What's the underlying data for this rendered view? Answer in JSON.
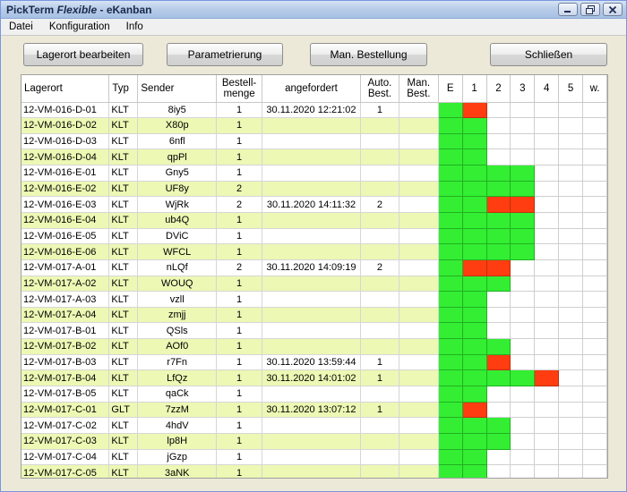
{
  "window": {
    "title_part1": "PickTerm ",
    "title_part2": "Flexible",
    "title_part3": " - eKanban",
    "minimize_icon": "minimize-icon",
    "maximize_icon": "restore-icon",
    "close_icon": "close-icon"
  },
  "menu": {
    "items": [
      "Datei",
      "Konfiguration",
      "Info"
    ]
  },
  "toolbar": {
    "edit_label": "Lagerort bearbeiten",
    "params_label": "Parametrierung",
    "order_label": "Man. Bestellung",
    "close_label": "Schließen"
  },
  "table": {
    "headers": {
      "lagerort": "Lagerort",
      "typ": "Typ",
      "sender": "Sender",
      "bestellmenge_1": "Bestell-",
      "bestellmenge_2": "menge",
      "angefordert": "angefordert",
      "auto_1": "Auto.",
      "auto_2": "Best.",
      "man_1": "Man.",
      "man_2": "Best.",
      "e": "E",
      "b1": "1",
      "b2": "2",
      "b3": "3",
      "b4": "4",
      "b5": "5",
      "w": "w."
    },
    "status_colors": {
      "ok": "#33ee33",
      "alert": "#ff3d10",
      "stripe": "#ecf8b4"
    },
    "rows": [
      {
        "lagerort": "12-VM-016-D-01",
        "typ": "KLT",
        "sender": "8iy5",
        "menge": "1",
        "angefordert": "30.11.2020 12:21:02",
        "auto": "1",
        "man": "",
        "bins": [
          "g",
          "r",
          "",
          "",
          "",
          "",
          ""
        ]
      },
      {
        "lagerort": "12-VM-016-D-02",
        "typ": "KLT",
        "sender": "X80p",
        "menge": "1",
        "angefordert": "",
        "auto": "",
        "man": "",
        "bins": [
          "g",
          "g",
          "",
          "",
          "",
          "",
          ""
        ]
      },
      {
        "lagerort": "12-VM-016-D-03",
        "typ": "KLT",
        "sender": "6nfl",
        "menge": "1",
        "angefordert": "",
        "auto": "",
        "man": "",
        "bins": [
          "g",
          "g",
          "",
          "",
          "",
          "",
          ""
        ]
      },
      {
        "lagerort": "12-VM-016-D-04",
        "typ": "KLT",
        "sender": "qpPl",
        "menge": "1",
        "angefordert": "",
        "auto": "",
        "man": "",
        "bins": [
          "g",
          "g",
          "",
          "",
          "",
          "",
          ""
        ]
      },
      {
        "lagerort": "12-VM-016-E-01",
        "typ": "KLT",
        "sender": "Gny5",
        "menge": "1",
        "angefordert": "",
        "auto": "",
        "man": "",
        "bins": [
          "g",
          "g",
          "g",
          "g",
          "",
          "",
          ""
        ]
      },
      {
        "lagerort": "12-VM-016-E-02",
        "typ": "KLT",
        "sender": "UF8y",
        "menge": "2",
        "angefordert": "",
        "auto": "",
        "man": "",
        "bins": [
          "g",
          "g",
          "g",
          "g",
          "",
          "",
          ""
        ]
      },
      {
        "lagerort": "12-VM-016-E-03",
        "typ": "KLT",
        "sender": "WjRk",
        "menge": "2",
        "angefordert": "30.11.2020 14:11:32",
        "auto": "2",
        "man": "",
        "bins": [
          "g",
          "g",
          "r",
          "r",
          "",
          "",
          ""
        ]
      },
      {
        "lagerort": "12-VM-016-E-04",
        "typ": "KLT",
        "sender": "ub4Q",
        "menge": "1",
        "angefordert": "",
        "auto": "",
        "man": "",
        "bins": [
          "g",
          "g",
          "g",
          "g",
          "",
          "",
          ""
        ]
      },
      {
        "lagerort": "12-VM-016-E-05",
        "typ": "KLT",
        "sender": "DViC",
        "menge": "1",
        "angefordert": "",
        "auto": "",
        "man": "",
        "bins": [
          "g",
          "g",
          "g",
          "g",
          "",
          "",
          ""
        ]
      },
      {
        "lagerort": "12-VM-016-E-06",
        "typ": "KLT",
        "sender": "WFCL",
        "menge": "1",
        "angefordert": "",
        "auto": "",
        "man": "",
        "bins": [
          "g",
          "g",
          "g",
          "g",
          "",
          "",
          ""
        ]
      },
      {
        "lagerort": "12-VM-017-A-01",
        "typ": "KLT",
        "sender": "nLQf",
        "menge": "2",
        "angefordert": "30.11.2020 14:09:19",
        "auto": "2",
        "man": "",
        "bins": [
          "g",
          "r",
          "r",
          "",
          "",
          "",
          ""
        ]
      },
      {
        "lagerort": "12-VM-017-A-02",
        "typ": "KLT",
        "sender": "WOUQ",
        "menge": "1",
        "angefordert": "",
        "auto": "",
        "man": "",
        "bins": [
          "g",
          "g",
          "g",
          "",
          "",
          "",
          ""
        ]
      },
      {
        "lagerort": "12-VM-017-A-03",
        "typ": "KLT",
        "sender": "vzll",
        "menge": "1",
        "angefordert": "",
        "auto": "",
        "man": "",
        "bins": [
          "g",
          "g",
          "",
          "",
          "",
          "",
          ""
        ]
      },
      {
        "lagerort": "12-VM-017-A-04",
        "typ": "KLT",
        "sender": "zmjj",
        "menge": "1",
        "angefordert": "",
        "auto": "",
        "man": "",
        "bins": [
          "g",
          "g",
          "",
          "",
          "",
          "",
          ""
        ]
      },
      {
        "lagerort": "12-VM-017-B-01",
        "typ": "KLT",
        "sender": "QSls",
        "menge": "1",
        "angefordert": "",
        "auto": "",
        "man": "",
        "bins": [
          "g",
          "g",
          "",
          "",
          "",
          "",
          ""
        ]
      },
      {
        "lagerort": "12-VM-017-B-02",
        "typ": "KLT",
        "sender": "AOf0",
        "menge": "1",
        "angefordert": "",
        "auto": "",
        "man": "",
        "bins": [
          "g",
          "g",
          "g",
          "",
          "",
          "",
          ""
        ]
      },
      {
        "lagerort": "12-VM-017-B-03",
        "typ": "KLT",
        "sender": "r7Fn",
        "menge": "1",
        "angefordert": "30.11.2020 13:59:44",
        "auto": "1",
        "man": "",
        "bins": [
          "g",
          "g",
          "r",
          "",
          "",
          "",
          ""
        ]
      },
      {
        "lagerort": "12-VM-017-B-04",
        "typ": "KLT",
        "sender": "LfQz",
        "menge": "1",
        "angefordert": "30.11.2020 14:01:02",
        "auto": "1",
        "man": "",
        "bins": [
          "g",
          "g",
          "g",
          "g",
          "r",
          "",
          ""
        ]
      },
      {
        "lagerort": "12-VM-017-B-05",
        "typ": "KLT",
        "sender": "qaCk",
        "menge": "1",
        "angefordert": "",
        "auto": "",
        "man": "",
        "bins": [
          "g",
          "g",
          "",
          "",
          "",
          "",
          ""
        ]
      },
      {
        "lagerort": "12-VM-017-C-01",
        "typ": "GLT",
        "sender": "7zzM",
        "menge": "1",
        "angefordert": "30.11.2020 13:07:12",
        "auto": "1",
        "man": "",
        "bins": [
          "g",
          "r",
          "",
          "",
          "",
          "",
          ""
        ]
      },
      {
        "lagerort": "12-VM-017-C-02",
        "typ": "KLT",
        "sender": "4hdV",
        "menge": "1",
        "angefordert": "",
        "auto": "",
        "man": "",
        "bins": [
          "g",
          "g",
          "g",
          "",
          "",
          "",
          ""
        ]
      },
      {
        "lagerort": "12-VM-017-C-03",
        "typ": "KLT",
        "sender": "lp8H",
        "menge": "1",
        "angefordert": "",
        "auto": "",
        "man": "",
        "bins": [
          "g",
          "g",
          "g",
          "",
          "",
          "",
          ""
        ]
      },
      {
        "lagerort": "12-VM-017-C-04",
        "typ": "KLT",
        "sender": "jGzp",
        "menge": "1",
        "angefordert": "",
        "auto": "",
        "man": "",
        "bins": [
          "g",
          "g",
          "",
          "",
          "",
          "",
          ""
        ]
      },
      {
        "lagerort": "12-VM-017-C-05",
        "typ": "KLT",
        "sender": "3aNK",
        "menge": "1",
        "angefordert": "",
        "auto": "",
        "man": "",
        "bins": [
          "g",
          "g",
          "",
          "",
          "",
          "",
          ""
        ]
      }
    ]
  }
}
